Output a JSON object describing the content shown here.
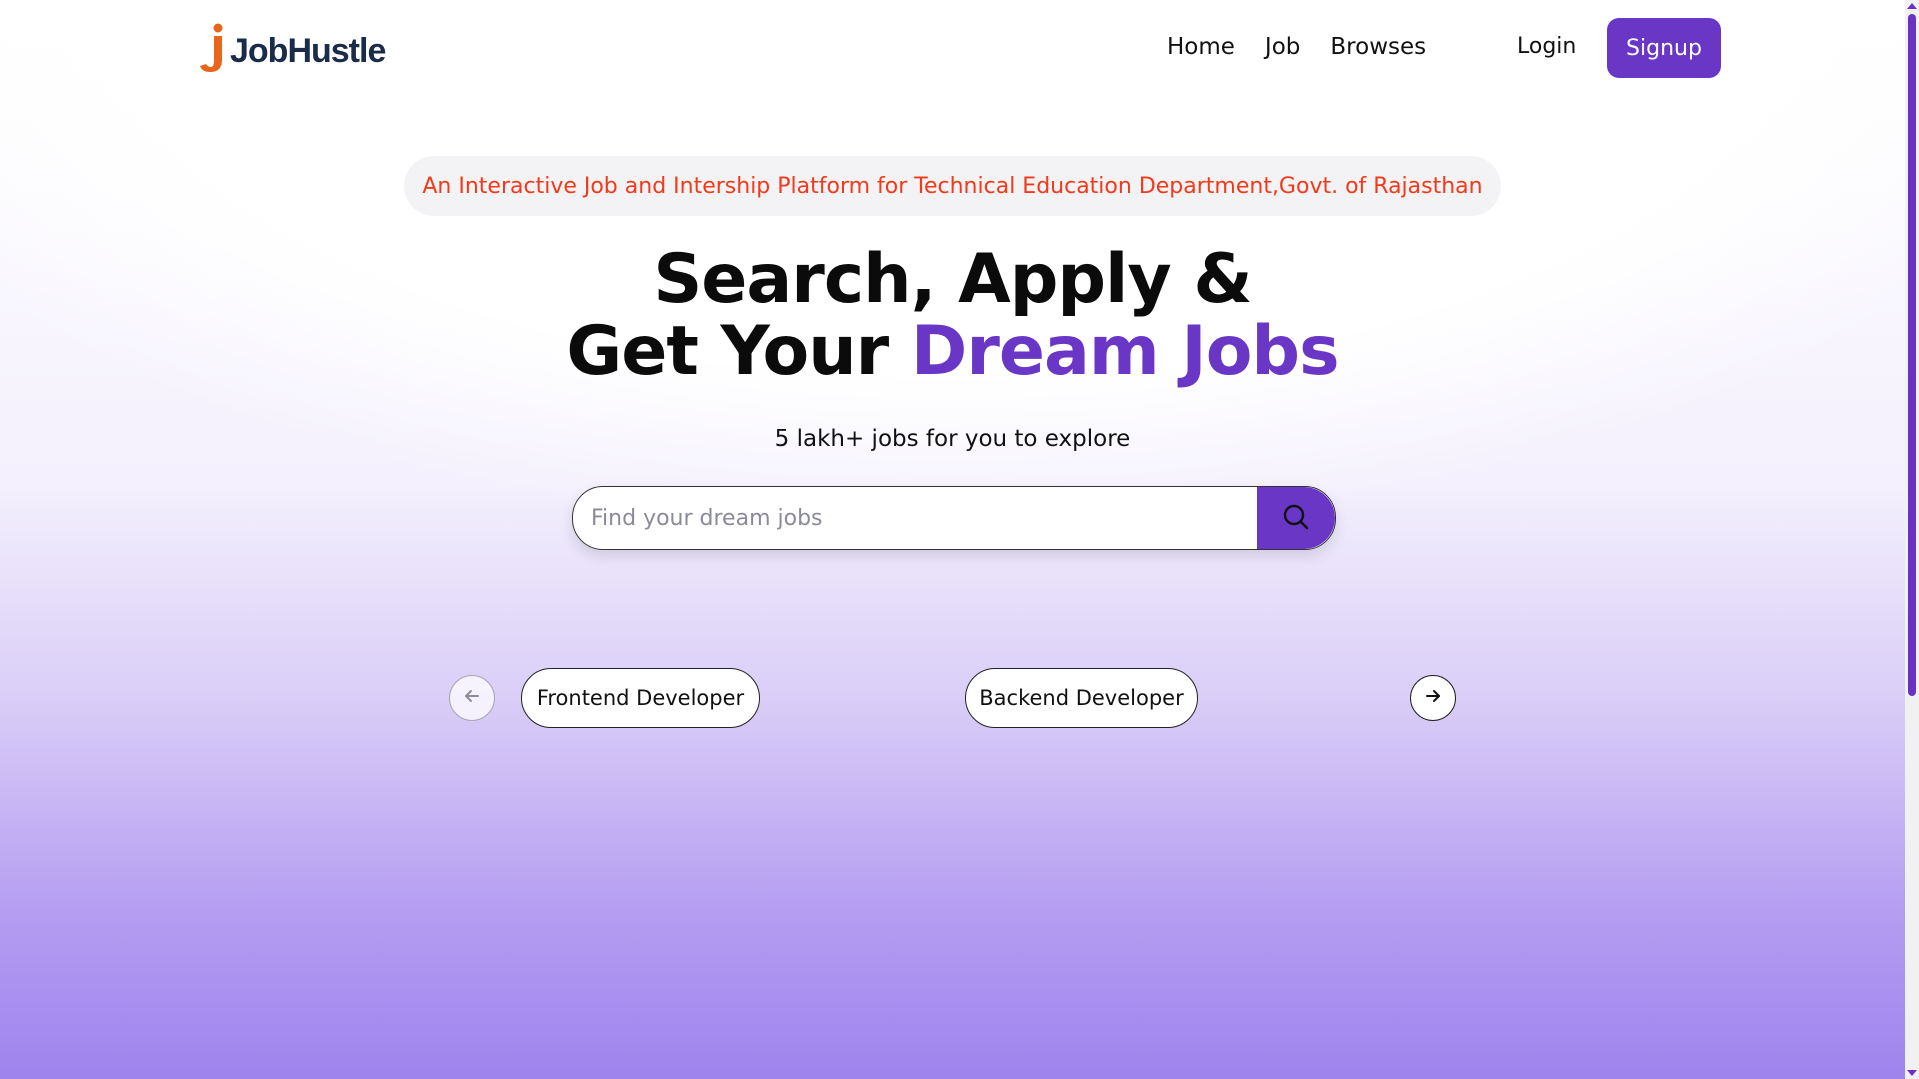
{
  "brand": {
    "logo_letter": "j",
    "name": "JobHustle",
    "logo_color": "#e8651a",
    "text_color": "#1b2b4a"
  },
  "nav": {
    "links": [
      {
        "label": "Home"
      },
      {
        "label": "Job"
      },
      {
        "label": "Browses"
      }
    ],
    "login_label": "Login",
    "signup_label": "Signup"
  },
  "hero": {
    "tagline": "An Interactive Job and Intership Platform for Technical Education Department,Govt. of Rajasthan",
    "headline_line1": "Search, Apply &",
    "headline_line2_prefix": "Get Your ",
    "headline_line2_accent": "Dream Jobs",
    "subline": "5 lakh+ jobs for you to explore"
  },
  "search": {
    "placeholder": "Find your dream jobs",
    "value": "",
    "icon": "search-icon"
  },
  "categories": {
    "items": [
      {
        "label": "Frontend Developer"
      },
      {
        "label": "Backend Developer"
      }
    ],
    "prev_icon": "arrow-left-icon",
    "next_icon": "arrow-right-icon"
  },
  "colors": {
    "accent": "#6a36c6",
    "tagline": "#f23a1b"
  }
}
